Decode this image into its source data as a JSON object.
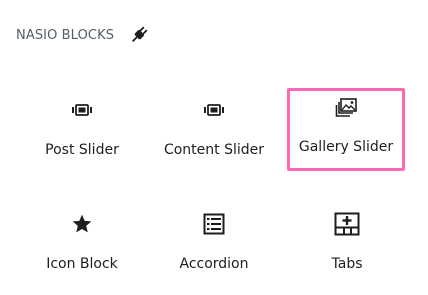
{
  "panel": {
    "title": "NASIO BLOCKS",
    "icon": "plug-icon"
  },
  "blocks": [
    {
      "label": "Post Slider",
      "icon": "slider-icon"
    },
    {
      "label": "Content Slider",
      "icon": "slider-icon"
    },
    {
      "label": "Gallery Slider",
      "icon": "gallery-icon",
      "selected": true
    },
    {
      "label": "Icon Block",
      "icon": "star-icon"
    },
    {
      "label": "Accordion",
      "icon": "accordion-icon"
    },
    {
      "label": "Tabs",
      "icon": "tabs-icon"
    }
  ],
  "colors": {
    "selection_outline": "#ff69b4",
    "text": "#1e1e1e",
    "header_text": "#555d66"
  }
}
